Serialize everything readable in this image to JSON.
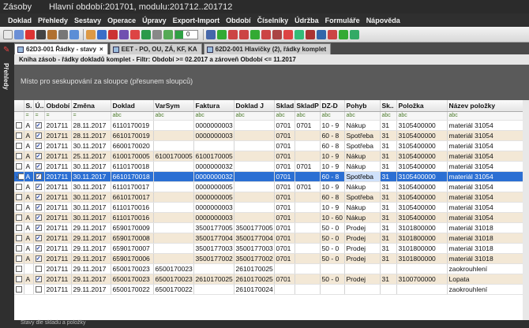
{
  "window": {
    "app_title": "Zásoby",
    "subtitle": "Hlavní období:201701, modulu:201712..201712"
  },
  "menu": [
    "Doklad",
    "Přehledy",
    "Sestavy",
    "Operace",
    "Úpravy",
    "Export-Import",
    "Období",
    "Číselníky",
    "Údržba",
    "Formuláře",
    "Nápověda"
  ],
  "toolbar": {
    "counter_value": "0"
  },
  "tabs": [
    {
      "label": "62D3-001 Řádky - stavy",
      "active": true
    },
    {
      "label": "EET - PO, OU, ZÁ, KF, KA",
      "active": false
    },
    {
      "label": "62D2-001 Hlavičky (2), řádky komplet",
      "active": false
    }
  ],
  "sidebar": {
    "label": "Přehledy"
  },
  "filter_text": "Kniha zásob - řádky dokladů komplet - Filtr: Období >= 02.2017  a zároveň  Období <= 11.2017",
  "group_hint": "Místo pro seskupování za sloupce (přesunem sloupců)",
  "columns": [
    "",
    "S.",
    "Ú..",
    "Období",
    "Změna",
    "Doklad",
    "VarSym",
    "Faktura",
    "Doklad J",
    "Sklad",
    "SkladP",
    "DZ-D",
    "Pohyb",
    "Sk..",
    "Položka",
    "Název položky"
  ],
  "filter_row": [
    "",
    "=",
    "=",
    "=",
    "=",
    "abc",
    "abc",
    "abc",
    "abc",
    "abc",
    "abc",
    "abc",
    "abc",
    "abc",
    "abc",
    "abc"
  ],
  "rows": [
    {
      "s": "A",
      "u": true,
      "obdobi": "201711",
      "zmena": "28.11.2017",
      "doklad": "6110170019",
      "varsym": "",
      "faktura": "0000000003",
      "dokladj": "",
      "sklad": "0701",
      "skladp": "0701",
      "dzd": "10 - 9",
      "pohyb": "Nákup",
      "sk": "31",
      "polozka": "3105400000",
      "nazev": "materiál 31054"
    },
    {
      "s": "A",
      "u": true,
      "obdobi": "201711",
      "zmena": "28.11.2017",
      "doklad": "6610170019",
      "varsym": "",
      "faktura": "0000000003",
      "dokladj": "",
      "sklad": "0701",
      "skladp": "",
      "dzd": "60 - 8",
      "pohyb": "Spotřeba",
      "sk": "31",
      "polozka": "3105400000",
      "nazev": "materiál 31054"
    },
    {
      "s": "A",
      "u": true,
      "obdobi": "201711",
      "zmena": "30.11.2017",
      "doklad": "6600170020",
      "varsym": "",
      "faktura": "",
      "dokladj": "",
      "sklad": "0701",
      "skladp": "",
      "dzd": "60 - 8",
      "pohyb": "Spotřeba",
      "sk": "31",
      "polozka": "3105400000",
      "nazev": "materiál 31054"
    },
    {
      "s": "A",
      "u": true,
      "obdobi": "201711",
      "zmena": "25.11.2017",
      "doklad": "6100170005",
      "varsym": "6100170005",
      "faktura": "6100170005",
      "dokladj": "",
      "sklad": "0701",
      "skladp": "",
      "dzd": "10 - 9",
      "pohyb": "Nákup",
      "sk": "31",
      "polozka": "3105400000",
      "nazev": "materiál 31054"
    },
    {
      "s": "A",
      "u": true,
      "obdobi": "201711",
      "zmena": "30.11.2017",
      "doklad": "6110170018",
      "varsym": "",
      "faktura": "0000000032",
      "dokladj": "",
      "sklad": "0701",
      "skladp": "0701",
      "dzd": "10 - 9",
      "pohyb": "Nákup",
      "sk": "31",
      "polozka": "3105400000",
      "nazev": "materiál 31054"
    },
    {
      "s": "A",
      "u": true,
      "obdobi": "201711",
      "zmena": "30.11.2017",
      "doklad": "6610170018",
      "varsym": "",
      "faktura": "0000000032",
      "dokladj": "",
      "sklad": "0701",
      "skladp": "",
      "dzd": "60 - 8",
      "pohyb": "Spotřeba",
      "sk": "31",
      "polozka": "3105400000",
      "nazev": "materiál 31054",
      "selected": true
    },
    {
      "s": "A",
      "u": true,
      "obdobi": "201711",
      "zmena": "30.11.2017",
      "doklad": "6110170017",
      "varsym": "",
      "faktura": "0000000005",
      "dokladj": "",
      "sklad": "0701",
      "skladp": "0701",
      "dzd": "10 - 9",
      "pohyb": "Nákup",
      "sk": "31",
      "polozka": "3105400000",
      "nazev": "materiál 31054"
    },
    {
      "s": "A",
      "u": true,
      "obdobi": "201711",
      "zmena": "30.11.2017",
      "doklad": "6610170017",
      "varsym": "",
      "faktura": "0000000005",
      "dokladj": "",
      "sklad": "0701",
      "skladp": "",
      "dzd": "60 - 8",
      "pohyb": "Spotřeba",
      "sk": "31",
      "polozka": "3105400000",
      "nazev": "materiál 31054"
    },
    {
      "s": "A",
      "u": true,
      "obdobi": "201711",
      "zmena": "30.11.2017",
      "doklad": "6110170016",
      "varsym": "",
      "faktura": "0000000003",
      "dokladj": "",
      "sklad": "0701",
      "skladp": "",
      "dzd": "10 - 9",
      "pohyb": "Nákup",
      "sk": "31",
      "polozka": "3105400000",
      "nazev": "materiál 31054"
    },
    {
      "s": "A",
      "u": true,
      "obdobi": "201711",
      "zmena": "30.11.2017",
      "doklad": "6110170016",
      "varsym": "",
      "faktura": "0000000003",
      "dokladj": "",
      "sklad": "0701",
      "skladp": "",
      "dzd": "10 - 60",
      "pohyb": "Nákup",
      "sk": "31",
      "polozka": "3105400000",
      "nazev": "materiál 31054"
    },
    {
      "s": "A",
      "u": true,
      "obdobi": "201711",
      "zmena": "29.11.2017",
      "doklad": "6590170009",
      "varsym": "",
      "faktura": "3500177005",
      "dokladj": "3500177005",
      "sklad": "0701",
      "skladp": "",
      "dzd": "50 - 0",
      "pohyb": "Prodej",
      "sk": "31",
      "polozka": "3101800000",
      "nazev": "materiál 31018"
    },
    {
      "s": "A",
      "u": true,
      "obdobi": "201711",
      "zmena": "29.11.2017",
      "doklad": "6590170008",
      "varsym": "",
      "faktura": "3500177004",
      "dokladj": "3500177004",
      "sklad": "0701",
      "skladp": "",
      "dzd": "50 - 0",
      "pohyb": "Prodej",
      "sk": "31",
      "polozka": "3101800000",
      "nazev": "materiál 31018"
    },
    {
      "s": "A",
      "u": true,
      "obdobi": "201711",
      "zmena": "29.11.2017",
      "doklad": "6590170007",
      "varsym": "",
      "faktura": "3500177003",
      "dokladj": "3500177003",
      "sklad": "0701",
      "skladp": "",
      "dzd": "50 - 0",
      "pohyb": "Prodej",
      "sk": "31",
      "polozka": "3101800000",
      "nazev": "materiál 31018"
    },
    {
      "s": "A",
      "u": true,
      "obdobi": "201711",
      "zmena": "29.11.2017",
      "doklad": "6590170006",
      "varsym": "",
      "faktura": "3500177002",
      "dokladj": "3500177002",
      "sklad": "0701",
      "skladp": "",
      "dzd": "50 - 0",
      "pohyb": "Prodej",
      "sk": "31",
      "polozka": "3101800000",
      "nazev": "materiál 31018"
    },
    {
      "s": "",
      "u": false,
      "obdobi": "201711",
      "zmena": "29.11.2017",
      "doklad": "6500170023",
      "varsym": "6500170023",
      "faktura": "",
      "dokladj": "2610170025",
      "sklad": "",
      "skladp": "",
      "dzd": "",
      "pohyb": "",
      "sk": "",
      "polozka": "",
      "nazev": "zaokrouhlení"
    },
    {
      "s": "A",
      "u": true,
      "obdobi": "201711",
      "zmena": "29.11.2017",
      "doklad": "6500170023",
      "varsym": "6500170023",
      "faktura": "2610170025",
      "dokladj": "2610170025",
      "sklad": "0701",
      "skladp": "",
      "dzd": "50 - 0",
      "pohyb": "Prodej",
      "sk": "31",
      "polozka": "3100700000",
      "nazev": "Lopata"
    },
    {
      "s": "",
      "u": false,
      "obdobi": "201711",
      "zmena": "29.11.2017",
      "doklad": "6500170022",
      "varsym": "6500170022",
      "faktura": "",
      "dokladj": "2610170024",
      "sklad": "",
      "skladp": "",
      "dzd": "",
      "pohyb": "",
      "sk": "",
      "polozka": "",
      "nazev": "zaokrouhlení"
    }
  ],
  "status_text": "Stavy dle skladu a položky",
  "colors": {
    "selected_row": "#2b6fd3",
    "alt_row": "#f3e8d6",
    "titlebar": "#2b2b2b"
  }
}
